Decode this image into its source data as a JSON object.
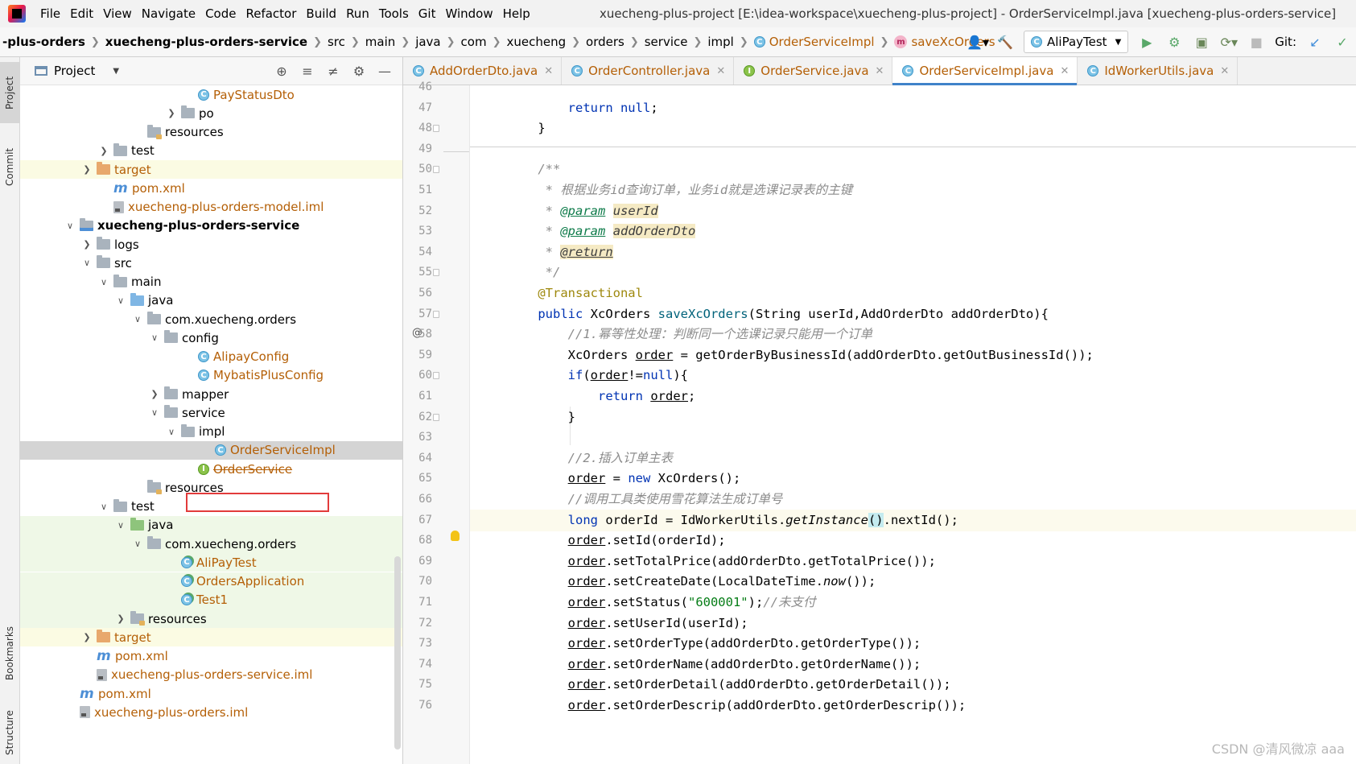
{
  "menu": [
    "File",
    "Edit",
    "View",
    "Navigate",
    "Code",
    "Refactor",
    "Build",
    "Run",
    "Tools",
    "Git",
    "Window",
    "Help"
  ],
  "window_title": "xuecheng-plus-project [E:\\idea-workspace\\xuecheng-plus-project] - OrderServiceImpl.java [xuecheng-plus-orders-service]",
  "breadcrumbs": [
    "-plus-orders",
    "xuecheng-plus-orders-service",
    "src",
    "main",
    "java",
    "com",
    "xuecheng",
    "orders",
    "service",
    "impl",
    "OrderServiceImpl",
    "saveXcOrders"
  ],
  "run_config": "AliPayTest",
  "git_label": "Git:",
  "project_panel": {
    "title": "Project"
  },
  "left_strip": {
    "project": "Project",
    "commit": "Commit",
    "bookmarks": "Bookmarks",
    "structure": "Structure"
  },
  "tree": [
    {
      "label": "PayStatusDto",
      "icon": "class-icon",
      "indent": 10,
      "arrow": "none",
      "style": "orange"
    },
    {
      "label": "po",
      "icon": "folder-icon",
      "indent": 9,
      "arrow": "collapsed",
      "style": ""
    },
    {
      "label": "resources",
      "icon": "resources-folder-icon",
      "indent": 7,
      "arrow": "none",
      "style": ""
    },
    {
      "label": "test",
      "icon": "folder-icon",
      "indent": 5,
      "arrow": "collapsed",
      "style": ""
    },
    {
      "label": "target",
      "icon": "target-folder-icon",
      "indent": 4,
      "arrow": "collapsed",
      "style": "orange",
      "row": "hl-yellow"
    },
    {
      "label": "pom.xml",
      "icon": "maven-icon",
      "indent": 5,
      "arrow": "none",
      "style": "orange"
    },
    {
      "label": "xuecheng-plus-orders-model.iml",
      "icon": "iml-icon",
      "indent": 5,
      "arrow": "none",
      "style": "orange"
    },
    {
      "label": "xuecheng-plus-orders-service",
      "icon": "module-folder-icon",
      "indent": 3,
      "arrow": "expanded",
      "style": "bold"
    },
    {
      "label": "logs",
      "icon": "folder-icon",
      "indent": 4,
      "arrow": "collapsed",
      "style": ""
    },
    {
      "label": "src",
      "icon": "folder-icon",
      "indent": 4,
      "arrow": "expanded",
      "style": ""
    },
    {
      "label": "main",
      "icon": "folder-icon",
      "indent": 5,
      "arrow": "expanded",
      "style": ""
    },
    {
      "label": "java",
      "icon": "source-folder-icon",
      "indent": 6,
      "arrow": "expanded",
      "style": ""
    },
    {
      "label": "com.xuecheng.orders",
      "icon": "package-icon",
      "indent": 7,
      "arrow": "expanded",
      "style": ""
    },
    {
      "label": "config",
      "icon": "package-icon",
      "indent": 8,
      "arrow": "expanded",
      "style": ""
    },
    {
      "label": "AlipayConfig",
      "icon": "class-icon",
      "indent": 10,
      "arrow": "none",
      "style": "orange"
    },
    {
      "label": "MybatisPlusConfig",
      "icon": "class-icon",
      "indent": 10,
      "arrow": "none",
      "style": "orange"
    },
    {
      "label": "mapper",
      "icon": "package-icon",
      "indent": 8,
      "arrow": "collapsed",
      "style": ""
    },
    {
      "label": "service",
      "icon": "package-icon",
      "indent": 8,
      "arrow": "expanded",
      "style": ""
    },
    {
      "label": "impl",
      "icon": "package-icon",
      "indent": 9,
      "arrow": "expanded",
      "style": ""
    },
    {
      "label": "OrderServiceImpl",
      "icon": "class-icon",
      "indent": 11,
      "arrow": "none",
      "style": "orange",
      "row": "hl-sel"
    },
    {
      "label": "OrderService",
      "icon": "interface-icon",
      "indent": 10,
      "arrow": "none",
      "style": "strike"
    },
    {
      "label": "resources",
      "icon": "resources-folder-icon",
      "indent": 7,
      "arrow": "none",
      "style": ""
    },
    {
      "label": "test",
      "icon": "folder-icon",
      "indent": 5,
      "arrow": "expanded",
      "style": ""
    },
    {
      "label": "java",
      "icon": "test-folder-icon",
      "indent": 6,
      "arrow": "expanded",
      "style": "",
      "row": "hl-green"
    },
    {
      "label": "com.xuecheng.orders",
      "icon": "package-icon",
      "indent": 7,
      "arrow": "expanded",
      "style": "",
      "row": "hl-green"
    },
    {
      "label": "AliPayTest",
      "icon": "test-class-icon",
      "indent": 9,
      "arrow": "none",
      "style": "orange",
      "row": "hl-green"
    },
    {
      "label": "OrdersApplication",
      "icon": "test-class-icon",
      "indent": 9,
      "arrow": "none",
      "style": "orange",
      "row": "hl-green"
    },
    {
      "label": "Test1",
      "icon": "test-class-icon",
      "indent": 9,
      "arrow": "none",
      "style": "orange",
      "row": "hl-green"
    },
    {
      "label": "resources",
      "icon": "test-resources-folder-icon",
      "indent": 6,
      "arrow": "collapsed",
      "style": "",
      "row": "hl-green"
    },
    {
      "label": "target",
      "icon": "target-folder-icon",
      "indent": 4,
      "arrow": "collapsed",
      "style": "orange",
      "row": "hl-yellow"
    },
    {
      "label": "pom.xml",
      "icon": "maven-icon",
      "indent": 4,
      "arrow": "none",
      "style": "orange"
    },
    {
      "label": "xuecheng-plus-orders-service.iml",
      "icon": "iml-icon",
      "indent": 4,
      "arrow": "none",
      "style": "orange"
    },
    {
      "label": "pom.xml",
      "icon": "maven-icon",
      "indent": 3,
      "arrow": "none",
      "style": "orange"
    },
    {
      "label": "xuecheng-plus-orders.iml",
      "icon": "iml-icon",
      "indent": 3,
      "arrow": "none",
      "style": "orange"
    }
  ],
  "tabs": [
    {
      "label": "AddOrderDto.java",
      "icon": "class-icon",
      "active": false
    },
    {
      "label": "OrderController.java",
      "icon": "class-icon",
      "active": false
    },
    {
      "label": "OrderService.java",
      "icon": "interface-icon",
      "active": false
    },
    {
      "label": "OrderServiceImpl.java",
      "icon": "class-icon",
      "active": true
    },
    {
      "label": "IdWorkerUtils.java",
      "icon": "class-icon",
      "active": false
    }
  ],
  "code_lines": [
    {
      "n": "46",
      "html": ""
    },
    {
      "n": "47",
      "html": "        <span class=\"kw\">return null</span>;"
    },
    {
      "n": "48",
      "html": "    }"
    },
    {
      "n": "49",
      "html": ""
    },
    {
      "n": "50",
      "html": "    <span class=\"doc\">/**</span>"
    },
    {
      "n": "51",
      "html": "     <span class=\"doc\">* 根据业务id查询订单，业务id就是选课记录表的主键</span>"
    },
    {
      "n": "52",
      "html": "     <span class=\"doc\">* </span><span class=\"doctag\">@param</span> <span class=\"docparam\">userId</span>"
    },
    {
      "n": "53",
      "html": "     <span class=\"doc\">* </span><span class=\"doctag\">@param</span> <span class=\"docparam\">addOrderDto</span>"
    },
    {
      "n": "54",
      "html": "     <span class=\"doc\">* </span><span class=\"doctag docparam\">@return</span>"
    },
    {
      "n": "55",
      "html": "     <span class=\"doc\">*/</span>"
    },
    {
      "n": "56",
      "html": "    <span class=\"ann\">@Transactional</span>"
    },
    {
      "n": "57",
      "html": "    <span class=\"kw\">public</span> XcOrders <span class=\"meth\">saveXcOrders</span>(String userId,AddOrderDto addOrderDto){"
    },
    {
      "n": "58",
      "html": "        <span class=\"cmt\">//1.幂等性处理：判断同一个选课记录只能用一个订单</span>"
    },
    {
      "n": "59",
      "html": "        XcOrders <span class=\"ul\">order</span> = getOrderByBusinessId(addOrderDto.getOutBusinessId());"
    },
    {
      "n": "60",
      "html": "        <span class=\"kw\">if</span>(<span class=\"ul\">order</span>!=<span class=\"kw\">null</span>){"
    },
    {
      "n": "61",
      "html": "            <span class=\"kw\">return</span> <span class=\"ul\">order</span>;"
    },
    {
      "n": "62",
      "html": "        }"
    },
    {
      "n": "63",
      "html": ""
    },
    {
      "n": "64",
      "html": "        <span class=\"cmt\">//2.插入订单主表</span>"
    },
    {
      "n": "65",
      "html": "        <span class=\"ul\">order</span> = <span class=\"kw\">new</span> XcOrders();"
    },
    {
      "n": "66",
      "html": "        <span class=\"cmt\">//调用工具类使用雪花算法生成订单号</span>"
    },
    {
      "n": "67",
      "html": "        <span class=\"kw\">long</span> orderId = IdWorkerUtils.<span class=\"it\">getInstance</span><span class=\"brk\">()</span>.nextId();"
    },
    {
      "n": "68",
      "html": "        <span class=\"ul\">order</span>.setId(orderId);"
    },
    {
      "n": "69",
      "html": "        <span class=\"ul\">order</span>.setTotalPrice(addOrderDto.getTotalPrice());"
    },
    {
      "n": "70",
      "html": "        <span class=\"ul\">order</span>.setCreateDate(LocalDateTime.<span class=\"it\">now</span>());"
    },
    {
      "n": "71",
      "html": "        <span class=\"ul\">order</span>.setStatus(<span class=\"str\">\"600001\"</span>);<span class=\"cmt\">//未支付</span>"
    },
    {
      "n": "72",
      "html": "        <span class=\"ul\">order</span>.setUserId(userId);"
    },
    {
      "n": "73",
      "html": "        <span class=\"ul\">order</span>.setOrderType(addOrderDto.getOrderType());"
    },
    {
      "n": "74",
      "html": "        <span class=\"ul\">order</span>.setOrderName(addOrderDto.getOrderName());"
    },
    {
      "n": "75",
      "html": "        <span class=\"ul\">order</span>.setOrderDetail(addOrderDto.getOrderDetail());"
    },
    {
      "n": "76",
      "html": "        <span class=\"ul\">order</span>.setOrderDescrip(addOrderDto.getOrderDescrip());"
    }
  ],
  "current_line": "67",
  "watermark": "CSDN @清风微凉 aaa"
}
